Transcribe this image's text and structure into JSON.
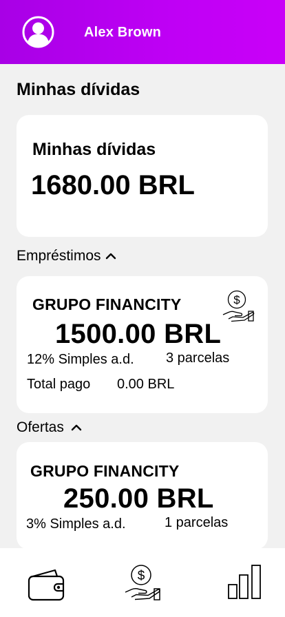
{
  "user": {
    "name": "Alex Brown",
    "avatar_icon": "user-circle-icon"
  },
  "page": {
    "title": "Minhas dívidas"
  },
  "summary": {
    "label": "Minhas dívidas",
    "amount": "1680.00 BRL"
  },
  "loans": {
    "header": "Empréstimos",
    "items": [
      {
        "lender": "GRUPO FINANCITY",
        "amount": "1500.00 BRL",
        "rate": "12% Simples a.d.",
        "installments": "3 parcelas",
        "paid_label": "Total pago",
        "paid_value": "0.00 BRL",
        "icon": "money-hand-icon"
      }
    ]
  },
  "offers": {
    "header": "Ofertas",
    "items": [
      {
        "lender": "GRUPO FINANCITY",
        "amount": "250.00 BRL",
        "rate": "3% Simples a.d.",
        "installments": "1 parcelas"
      }
    ]
  },
  "nav": {
    "items": [
      {
        "icon": "wallet-icon"
      },
      {
        "icon": "money-hand-icon"
      },
      {
        "icon": "bar-chart-icon"
      }
    ]
  },
  "colors": {
    "header_start": "#a800e6",
    "header_end": "#c900f8",
    "background": "#f1f1f1",
    "card": "#ffffff"
  }
}
